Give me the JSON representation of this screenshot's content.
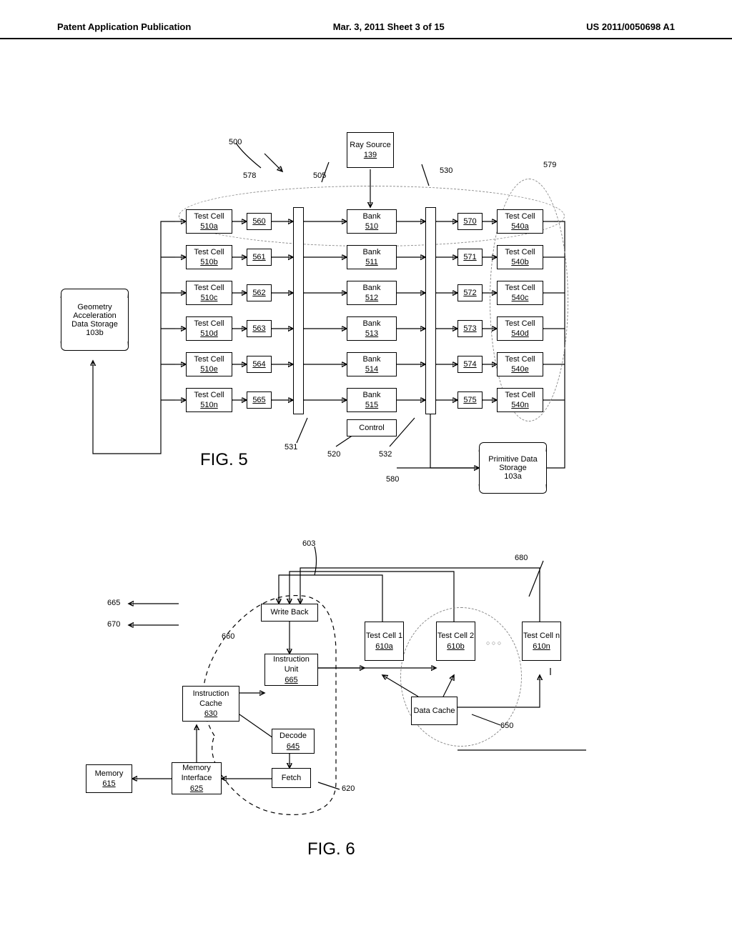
{
  "header": {
    "left": "Patent Application Publication",
    "center": "Mar. 3, 2011  Sheet 3 of 15",
    "right": "US 2011/0050698 A1"
  },
  "fig5": {
    "title": "FIG. 5",
    "ray_source": "Ray Source",
    "ray_source_ref": "139",
    "geom_storage_l1": "Geometry",
    "geom_storage_l2": "Acceleration",
    "geom_storage_l3": "Data Storage",
    "geom_storage_ref": "103b",
    "prim_storage_l1": "Primitive Data",
    "prim_storage_l2": "Storage",
    "prim_storage_ref": "103a",
    "control": "Control",
    "labels": {
      "l500": "500",
      "l578": "578",
      "l505": "505",
      "l530": "530",
      "l579": "579",
      "l531": "531",
      "l520": "520",
      "l532": "532",
      "l580": "580"
    },
    "left_cells": [
      {
        "name": "Test Cell",
        "ref": "510a"
      },
      {
        "name": "Test Cell",
        "ref": "510b"
      },
      {
        "name": "Test Cell",
        "ref": "510c"
      },
      {
        "name": "Test Cell",
        "ref": "510d"
      },
      {
        "name": "Test Cell",
        "ref": "510e"
      },
      {
        "name": "Test Cell",
        "ref": "510n"
      }
    ],
    "left_mid": [
      "560",
      "561",
      "562",
      "563",
      "564",
      "565"
    ],
    "banks": [
      {
        "name": "Bank",
        "ref": "510"
      },
      {
        "name": "Bank",
        "ref": "511"
      },
      {
        "name": "Bank",
        "ref": "512"
      },
      {
        "name": "Bank",
        "ref": "513"
      },
      {
        "name": "Bank",
        "ref": "514"
      },
      {
        "name": "Bank",
        "ref": "515"
      }
    ],
    "right_mid": [
      "570",
      "571",
      "572",
      "573",
      "574",
      "575"
    ],
    "right_cells": [
      {
        "name": "Test Cell",
        "ref": "540a"
      },
      {
        "name": "Test Cell",
        "ref": "540b"
      },
      {
        "name": "Test Cell",
        "ref": "540c"
      },
      {
        "name": "Test Cell",
        "ref": "540d"
      },
      {
        "name": "Test Cell",
        "ref": "540e"
      },
      {
        "name": "Test Cell",
        "ref": "540n"
      }
    ]
  },
  "fig6": {
    "title": "FIG. 6",
    "labels": {
      "l603": "603",
      "l680": "680",
      "l665": "665",
      "l670": "670",
      "l660": "660",
      "l650": "650",
      "l620": "620"
    },
    "write_back": "Write Back",
    "instr_unit": "Instruction Unit",
    "instr_unit_ref": "665",
    "instr_cache": "Instruction Cache",
    "instr_cache_ref": "630",
    "decode": "Decode",
    "decode_ref": "645",
    "fetch": "Fetch",
    "memory": "Memory",
    "memory_ref": "615",
    "mem_if": "Memory Interface",
    "mem_if_ref": "625",
    "data_cache": "Data Cache",
    "cells": [
      {
        "name": "Test Cell 1",
        "ref": "610a"
      },
      {
        "name": "Test Cell 2",
        "ref": "610b"
      },
      {
        "name": "Test Cell n",
        "ref": "610n"
      }
    ],
    "dots": "○   ○ ○"
  }
}
